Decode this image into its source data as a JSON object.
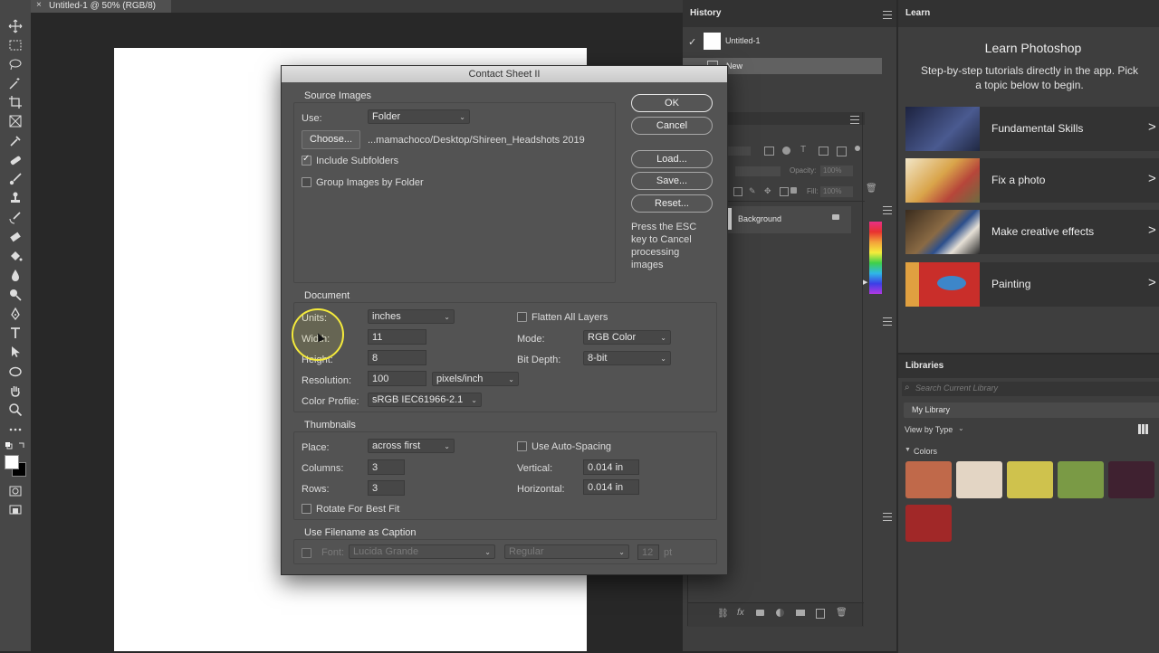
{
  "document": {
    "tab_close": "×",
    "tab_title": "Untitled-1 @ 50% (RGB/8)"
  },
  "history_panel": {
    "tab": "History",
    "items": [
      "Untitled-1",
      "New"
    ]
  },
  "layers_panel": {
    "opacity_label": "Opacity:",
    "opacity_value": "100%",
    "fill_label": "Fill:",
    "fill_value": "100%",
    "layer_name": "Background"
  },
  "learn_panel": {
    "tab": "Learn",
    "heading": "Learn Photoshop",
    "description": "Step-by-step tutorials directly in the app. Pick a topic below to begin.",
    "tutorials": [
      {
        "label": "Fundamental Skills",
        "thumb_color": "#2a3152"
      },
      {
        "label": "Fix a photo",
        "thumb_color": "#b79a6a"
      },
      {
        "label": "Make creative effects",
        "thumb_color": "#4a4136"
      },
      {
        "label": "Painting",
        "thumb_color": "#c9302c"
      }
    ]
  },
  "libraries_panel": {
    "tab": "Libraries",
    "search_placeholder": "Search Current Library",
    "library_select": "My Library",
    "view_by": "View by Type",
    "colors_heading": "Colors",
    "swatches": [
      "#c0694a",
      "#e3d5c4",
      "#cfc24d",
      "#7a9a45",
      "#3f2130",
      "#a12828"
    ]
  },
  "dialog": {
    "title": "Contact Sheet II",
    "buttons": {
      "ok": "OK",
      "cancel": "Cancel",
      "load": "Load...",
      "save": "Save...",
      "reset": "Reset..."
    },
    "esc_note": "Press the ESC key to Cancel processing images",
    "source": {
      "title": "Source Images",
      "use_label": "Use:",
      "use_value": "Folder",
      "choose_button": "Choose...",
      "path": "...mamachoco/Desktop/Shireen_Headshots 2019",
      "include_subfolders": "Include Subfolders",
      "include_subfolders_checked": true,
      "group_by_folder": "Group Images by Folder",
      "group_by_folder_checked": false
    },
    "document": {
      "title": "Document",
      "units_label": "Units:",
      "units_value": "inches",
      "width_label": "Width:",
      "width_value": "11",
      "height_label": "Height:",
      "height_value": "8",
      "resolution_label": "Resolution:",
      "resolution_value": "100",
      "resolution_unit": "pixels/inch",
      "profile_label": "Color Profile:",
      "profile_value": "sRGB IEC61966-2.1",
      "flatten_label": "Flatten All Layers",
      "flatten_checked": false,
      "mode_label": "Mode:",
      "mode_value": "RGB Color",
      "depth_label": "Bit Depth:",
      "depth_value": "8-bit"
    },
    "thumbnails": {
      "title": "Thumbnails",
      "place_label": "Place:",
      "place_value": "across first",
      "columns_label": "Columns:",
      "columns_value": "3",
      "rows_label": "Rows:",
      "rows_value": "3",
      "rotate_label": "Rotate For Best Fit",
      "rotate_checked": false,
      "autospacing_label": "Use Auto-Spacing",
      "autospacing_checked": false,
      "vertical_label": "Vertical:",
      "vertical_value": "0.014 in",
      "horizontal_label": "Horizontal:",
      "horizontal_value": "0.014 in"
    },
    "caption": {
      "title": "Use Filename as Caption",
      "font_label": "Font:",
      "font_value": "Lucida Grande",
      "style_value": "Regular",
      "size_value": "12",
      "size_unit": "pt"
    }
  }
}
